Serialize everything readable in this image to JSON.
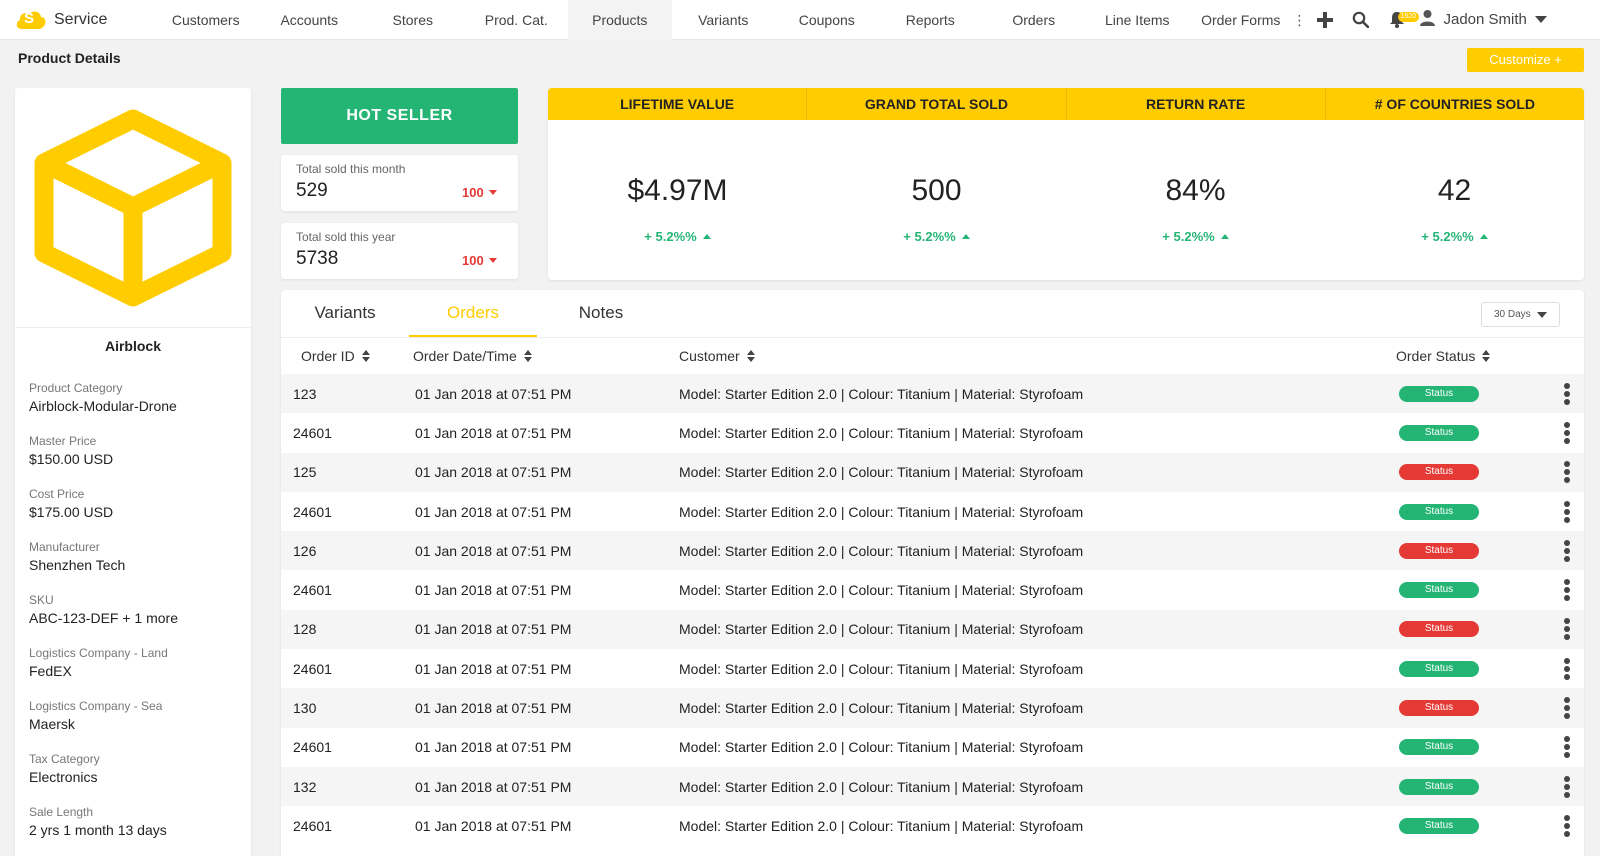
{
  "app": {
    "name": "Service",
    "logo_letter": "S"
  },
  "nav": {
    "items": [
      {
        "label": "Customers",
        "active": false
      },
      {
        "label": "Accounts",
        "active": false
      },
      {
        "label": "Stores",
        "active": false
      },
      {
        "label": "Prod. Cat.",
        "active": false
      },
      {
        "label": "Products",
        "active": true
      },
      {
        "label": "Variants",
        "active": false
      },
      {
        "label": "Coupons",
        "active": false
      },
      {
        "label": "Reports",
        "active": false
      },
      {
        "label": "Orders",
        "active": false
      },
      {
        "label": "Line Items",
        "active": false
      },
      {
        "label": "Order Forms",
        "active": false
      }
    ],
    "more_glyph": "⋮",
    "notification_count": "1520",
    "user_name": "Jadon Smith"
  },
  "page": {
    "title": "Product Details",
    "customize_label": "Customize +"
  },
  "product": {
    "name": "Airblock",
    "details": [
      {
        "label": "Product Category",
        "value": "Airblock-Modular-Drone"
      },
      {
        "label": "Master Price",
        "value": "$150.00 USD"
      },
      {
        "label": "Cost Price",
        "value": "$175.00 USD"
      },
      {
        "label": "Manufacturer",
        "value": "Shenzhen Tech"
      },
      {
        "label": "SKU",
        "value": "ABC-123-DEF + 1 more"
      },
      {
        "label": "Logistics Company - Land",
        "value": "FedEX"
      },
      {
        "label": "Logistics Company - Sea",
        "value": "Maersk"
      },
      {
        "label": "Tax Category",
        "value": "Electronics"
      },
      {
        "label": "Sale Length",
        "value": "2 yrs 1 month 13 days"
      }
    ]
  },
  "hot_seller": "HOT SELLER",
  "monthly": {
    "label": "Total sold this month",
    "value": "529",
    "delta": "100"
  },
  "yearly": {
    "label": "Total sold this year",
    "value": "5738",
    "delta": "100"
  },
  "stats": [
    {
      "header": "LIFETIME VALUE",
      "value": "$4.97M",
      "delta": "+ 5.2%%"
    },
    {
      "header": "GRAND TOTAL SOLD",
      "value": "500",
      "delta": "+ 5.2%%"
    },
    {
      "header": "RETURN RATE",
      "value": "84%",
      "delta": "+ 5.2%%"
    },
    {
      "header": "# OF COUNTRIES SOLD",
      "value": "42",
      "delta": "+ 5.2%%"
    }
  ],
  "tabs": [
    {
      "label": "Variants",
      "active": false
    },
    {
      "label": "Orders",
      "active": true
    },
    {
      "label": "Notes",
      "active": false
    }
  ],
  "range_select": "30 Days",
  "table": {
    "headers": {
      "order_id": "Order ID",
      "date": "Order Date/Time",
      "customer": "Customer",
      "status": "Order Status"
    },
    "rows": [
      {
        "id": "123",
        "date": "01 Jan 2018 at 07:51 PM",
        "customer": "Model: Starter Edition 2.0 | Colour: Titanium | Material: Styrofoam",
        "status": "Status",
        "status_color": "green"
      },
      {
        "id": "24601",
        "date": "01 Jan 2018 at 07:51 PM",
        "customer": "Model: Starter Edition 2.0 | Colour: Titanium | Material: Styrofoam",
        "status": "Status",
        "status_color": "green"
      },
      {
        "id": "125",
        "date": "01 Jan 2018 at 07:51 PM",
        "customer": "Model: Starter Edition 2.0 | Colour: Titanium | Material: Styrofoam",
        "status": "Status",
        "status_color": "red"
      },
      {
        "id": "24601",
        "date": "01 Jan 2018 at 07:51 PM",
        "customer": "Model: Starter Edition 2.0 | Colour: Titanium | Material: Styrofoam",
        "status": "Status",
        "status_color": "green"
      },
      {
        "id": "126",
        "date": "01 Jan 2018 at 07:51 PM",
        "customer": "Model: Starter Edition 2.0 | Colour: Titanium | Material: Styrofoam",
        "status": "Status",
        "status_color": "red"
      },
      {
        "id": "24601",
        "date": "01 Jan 2018 at 07:51 PM",
        "customer": "Model: Starter Edition 2.0 | Colour: Titanium | Material: Styrofoam",
        "status": "Status",
        "status_color": "green"
      },
      {
        "id": "128",
        "date": "01 Jan 2018 at 07:51 PM",
        "customer": "Model: Starter Edition 2.0 | Colour: Titanium | Material: Styrofoam",
        "status": "Status",
        "status_color": "red"
      },
      {
        "id": "24601",
        "date": "01 Jan 2018 at 07:51 PM",
        "customer": "Model: Starter Edition 2.0 | Colour: Titanium | Material: Styrofoam",
        "status": "Status",
        "status_color": "green"
      },
      {
        "id": "130",
        "date": "01 Jan 2018 at 07:51 PM",
        "customer": "Model: Starter Edition 2.0 | Colour: Titanium | Material: Styrofoam",
        "status": "Status",
        "status_color": "red"
      },
      {
        "id": "24601",
        "date": "01 Jan 2018 at 07:51 PM",
        "customer": "Model: Starter Edition 2.0 | Colour: Titanium | Material: Styrofoam",
        "status": "Status",
        "status_color": "green"
      },
      {
        "id": "132",
        "date": "01 Jan 2018 at 07:51 PM",
        "customer": "Model: Starter Edition 2.0 | Colour: Titanium | Material: Styrofoam",
        "status": "Status",
        "status_color": "green"
      },
      {
        "id": "24601",
        "date": "01 Jan 2018 at 07:51 PM",
        "customer": "Model: Starter Edition 2.0 | Colour: Titanium | Material: Styrofoam",
        "status": "Status",
        "status_color": "green"
      }
    ]
  },
  "colors": {
    "brand_yellow": "#ffcc00",
    "success_green": "#24b574",
    "danger_red": "#e53935"
  },
  "icons": [
    "cloud-logo-icon",
    "plus-icon",
    "search-icon",
    "bell-icon",
    "user-icon",
    "chevron-down-icon",
    "cube-icon",
    "sort-icon",
    "kebab-menu-icon"
  ]
}
